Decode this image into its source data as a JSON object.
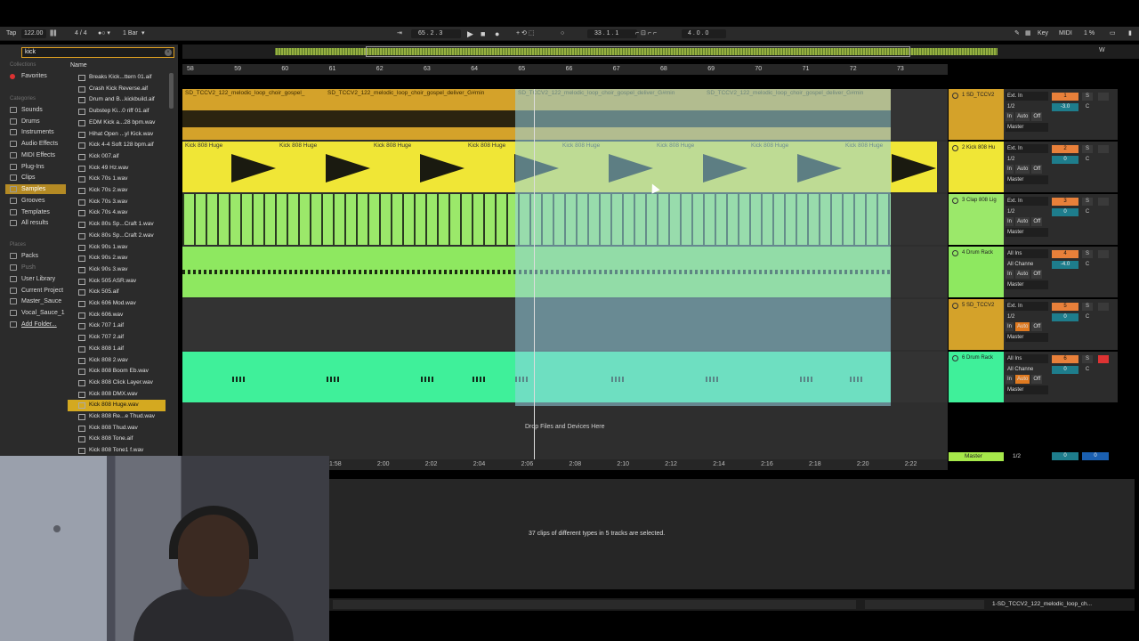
{
  "topbar": {
    "tap": "Tap",
    "tempo": "122.00",
    "time_sig": "4 / 4",
    "quantize": "1 Bar",
    "position": "65 .  2 .  3",
    "loop_start": "33 .  1 .  1",
    "loop_len": "4 .  0 .  0",
    "key": "Key",
    "midi": "MIDI",
    "cpu": "1 %",
    "w": "W"
  },
  "browser": {
    "search_value": "kick",
    "collections_header": "Collections",
    "favorites": "Favorites",
    "categories_header": "Categories",
    "categories": [
      "Sounds",
      "Drums",
      "Instruments",
      "Audio Effects",
      "MIDI Effects",
      "Plug-Ins",
      "Clips",
      "Samples",
      "Grooves",
      "Templates",
      "All results"
    ],
    "places_header": "Places",
    "places": [
      "Packs",
      "Push",
      "User Library",
      "Current Project",
      "Master_Sauce",
      "Vocal_Sauce_1",
      "Add Folder..."
    ],
    "name_header": "Name",
    "files": [
      "Breaks Kick...ttern 01.aif",
      "Crash Kick Reverse.aif",
      "Drum and B...kickbuild.aif",
      "Dubstep Ki...0 riff 01.aif",
      "EDM Kick a...28 bpm.wav",
      "Hihat Open ...yl Kick.wav",
      "Kick 4-4 Soft 128 bpm.aif",
      "Kick 007.aif",
      "Kick 49 Hz.wav",
      "Kick 70s 1.wav",
      "Kick 70s 2.wav",
      "Kick 70s 3.wav",
      "Kick 70s 4.wav",
      "Kick 80s Sp...Craft 1.wav",
      "Kick 80s Sp...Craft 2.wav",
      "Kick 90s 1.wav",
      "Kick 90s 2.wav",
      "Kick 90s 3.wav",
      "Kick 505 ASR.wav",
      "Kick 505.aif",
      "Kick 606 Mod.wav",
      "Kick 606.wav",
      "Kick 707 1.aif",
      "Kick 707 2.aif",
      "Kick 808 1.aif",
      "Kick 808 2.wav",
      "Kick 808 Boom Eb.wav",
      "Kick 808 Click Layer.wav",
      "Kick 808 DMX.wav",
      "Kick 808 Huge.wav",
      "Kick 808 Re...e Thud.wav",
      "Kick 808 Thud.wav",
      "Kick 808 Tone.aif",
      "Kick 808 Tone1 f.wav"
    ],
    "selected_file": "Kick 808 Huge.wav"
  },
  "ruler_bars": [
    "58",
    "59",
    "60",
    "61",
    "62",
    "63",
    "64",
    "65",
    "66",
    "67",
    "68",
    "69",
    "70",
    "71",
    "72",
    "73"
  ],
  "time_ruler": [
    "1:58",
    "2:00",
    "2:02",
    "2:04",
    "2:06",
    "2:08",
    "2:10",
    "2:12",
    "2:14",
    "2:16",
    "2:18",
    "2:20",
    "2:22"
  ],
  "clips": {
    "track1": [
      "SD_TCCV2_122_melodic_loop_choir_gospel_",
      "SD_TCCV2_122_melodic_loop_choir_gospel_deliver_G#min",
      "SD_TCCV2_122_melodic_loop_choir_gospel_deliver_G#min",
      "SD_TCCV2_122_melodic_loop_choir_gospel_deliver_G#min"
    ],
    "track2": [
      "Kick 808 Huge",
      "Kick 808 Huge",
      "Kick 808 Huge",
      "Kick 808 Huge",
      "Kick 808 Huge",
      "Kick 808 Huge",
      "Kick 808 Huge",
      "Kick 808 Huge"
    ]
  },
  "drop_text": "Drop Files and Devices Here",
  "tracks": [
    {
      "name": "1 SD_TCCV2",
      "color": "#d4a22a",
      "input": "Ext. In",
      "channel": "1/2",
      "monitor_in": "In",
      "monitor_auto": "Auto",
      "monitor_off": "Off",
      "output": "Master",
      "num": "1",
      "vol": "-3.0",
      "pan": "C",
      "solo": "S"
    },
    {
      "name": "2 Kick 808 Hu",
      "color": "#f0e636",
      "input": "Ext. In",
      "channel": "1/2",
      "monitor_in": "In",
      "monitor_auto": "Auto",
      "monitor_off": "Off",
      "output": "Master",
      "num": "2",
      "vol": "0",
      "pan": "C",
      "solo": "S"
    },
    {
      "name": "3 Clap 808 Lig",
      "color": "#9be86a",
      "input": "Ext. In",
      "channel": "1/2",
      "monitor_in": "In",
      "monitor_auto": "Auto",
      "monitor_off": "Off",
      "output": "Master",
      "num": "3",
      "vol": "0",
      "pan": "C",
      "solo": "S"
    },
    {
      "name": "4 Drum Rack",
      "color": "#8ee860",
      "input": "All Ins",
      "channel": "All Channe",
      "monitor_in": "In",
      "monitor_auto": "Auto",
      "monitor_off": "Off",
      "output": "Master",
      "num": "4",
      "vol": "-4.0",
      "pan": "C",
      "solo": "S"
    },
    {
      "name": "5 SD_TCCV2",
      "color": "#d4a22a",
      "input": "Ext. In",
      "channel": "1/2",
      "monitor_in": "In",
      "monitor_auto": "Auto",
      "monitor_off": "Off",
      "output": "Master",
      "num": "5",
      "vol": "0",
      "pan": "C",
      "solo": "S"
    },
    {
      "name": "6 Drum Rack",
      "color": "#3ff09a",
      "input": "All Ins",
      "channel": "All Channe",
      "monitor_in": "In",
      "monitor_auto": "Auto",
      "monitor_off": "Off",
      "output": "Master",
      "num": "6",
      "vol": "0",
      "pan": "C",
      "solo": "S"
    }
  ],
  "master": {
    "name": "Master",
    "channel": "1/2",
    "vol": "0",
    "pan": "0"
  },
  "detail_text": "37 clips of different types in 5 tracks are selected.",
  "status_text": "1-SD_TCCV2_122_melodic_loop_ch..."
}
